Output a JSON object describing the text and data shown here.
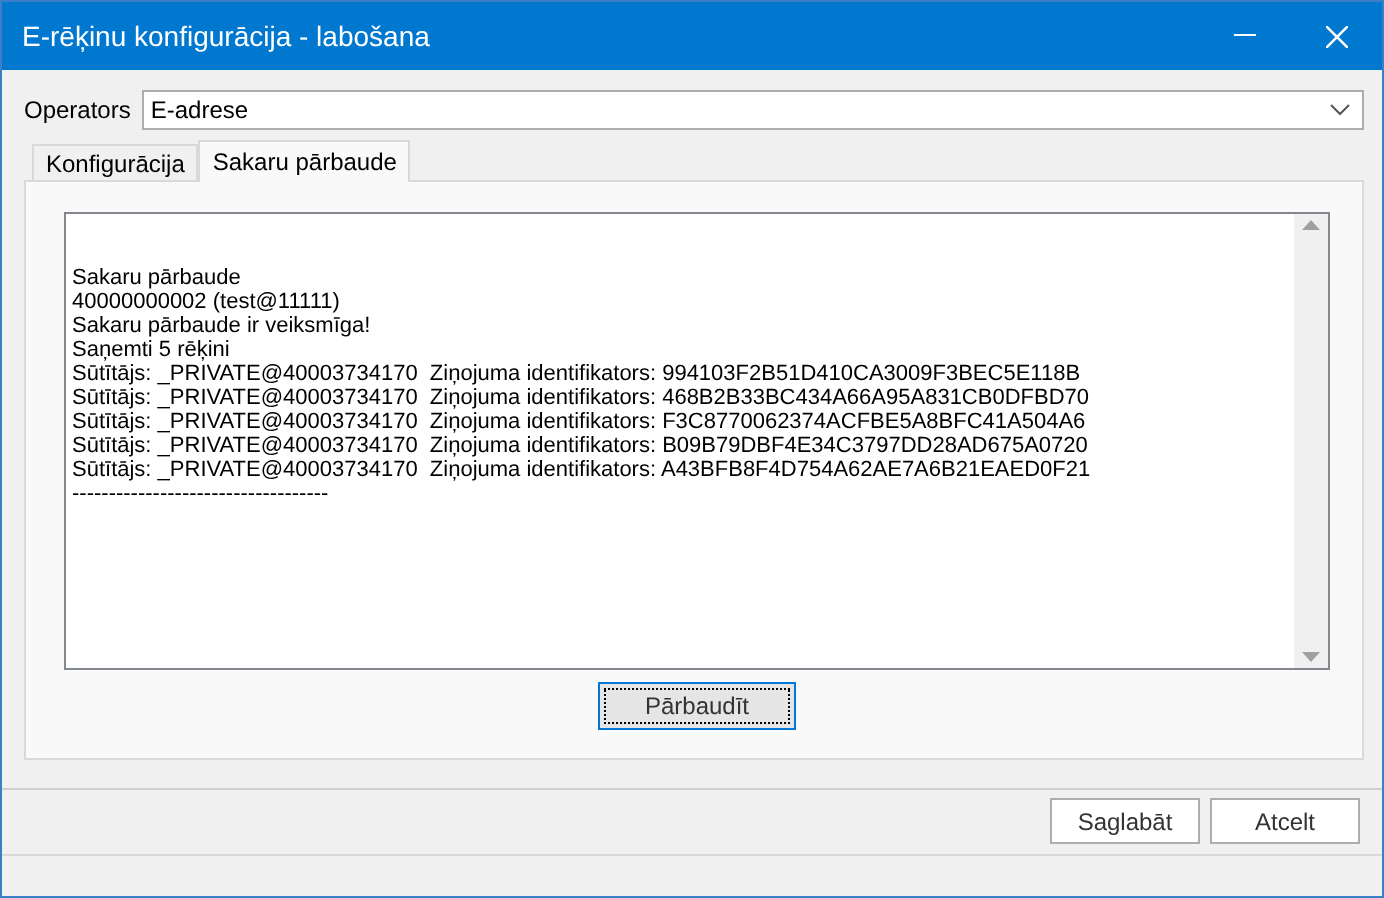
{
  "window": {
    "title": "E-rēķinu konfigurācija - labošana"
  },
  "operator": {
    "label": "Operators",
    "value": "E-adrese"
  },
  "tabs": [
    {
      "label": "Konfigurācija",
      "selected": false
    },
    {
      "label": "Sakaru pārbaude",
      "selected": true
    }
  ],
  "log": {
    "lines": [
      "Sakaru pārbaude",
      "40000000002 (test@11111)",
      "Sakaru pārbaude ir veiksmīga!",
      "Saņemti 5 rēķini",
      "Sūtītājs: _PRIVATE@40003734170  Ziņojuma identifikators: 994103F2B51D410CA3009F3BEC5E118B",
      "Sūtītājs: _PRIVATE@40003734170  Ziņojuma identifikators: 468B2B33BC434A66A95A831CB0DFBD70",
      "Sūtītājs: _PRIVATE@40003734170  Ziņojuma identifikators: F3C8770062374ACFBE5A8BFC41A504A6",
      "Sūtītājs: _PRIVATE@40003734170  Ziņojuma identifikators: B09B79DBF4E34C3797DD28AD675A0720",
      "Sūtītājs: _PRIVATE@40003734170  Ziņojuma identifikators: A43BFB8F4D754A62AE7A6B21EAED0F21",
      "-----------------------------------"
    ]
  },
  "check_button": {
    "label": "Pārbaudīt"
  },
  "buttons": [
    {
      "label": "Saglabāt"
    },
    {
      "label": "Atcelt"
    }
  ]
}
